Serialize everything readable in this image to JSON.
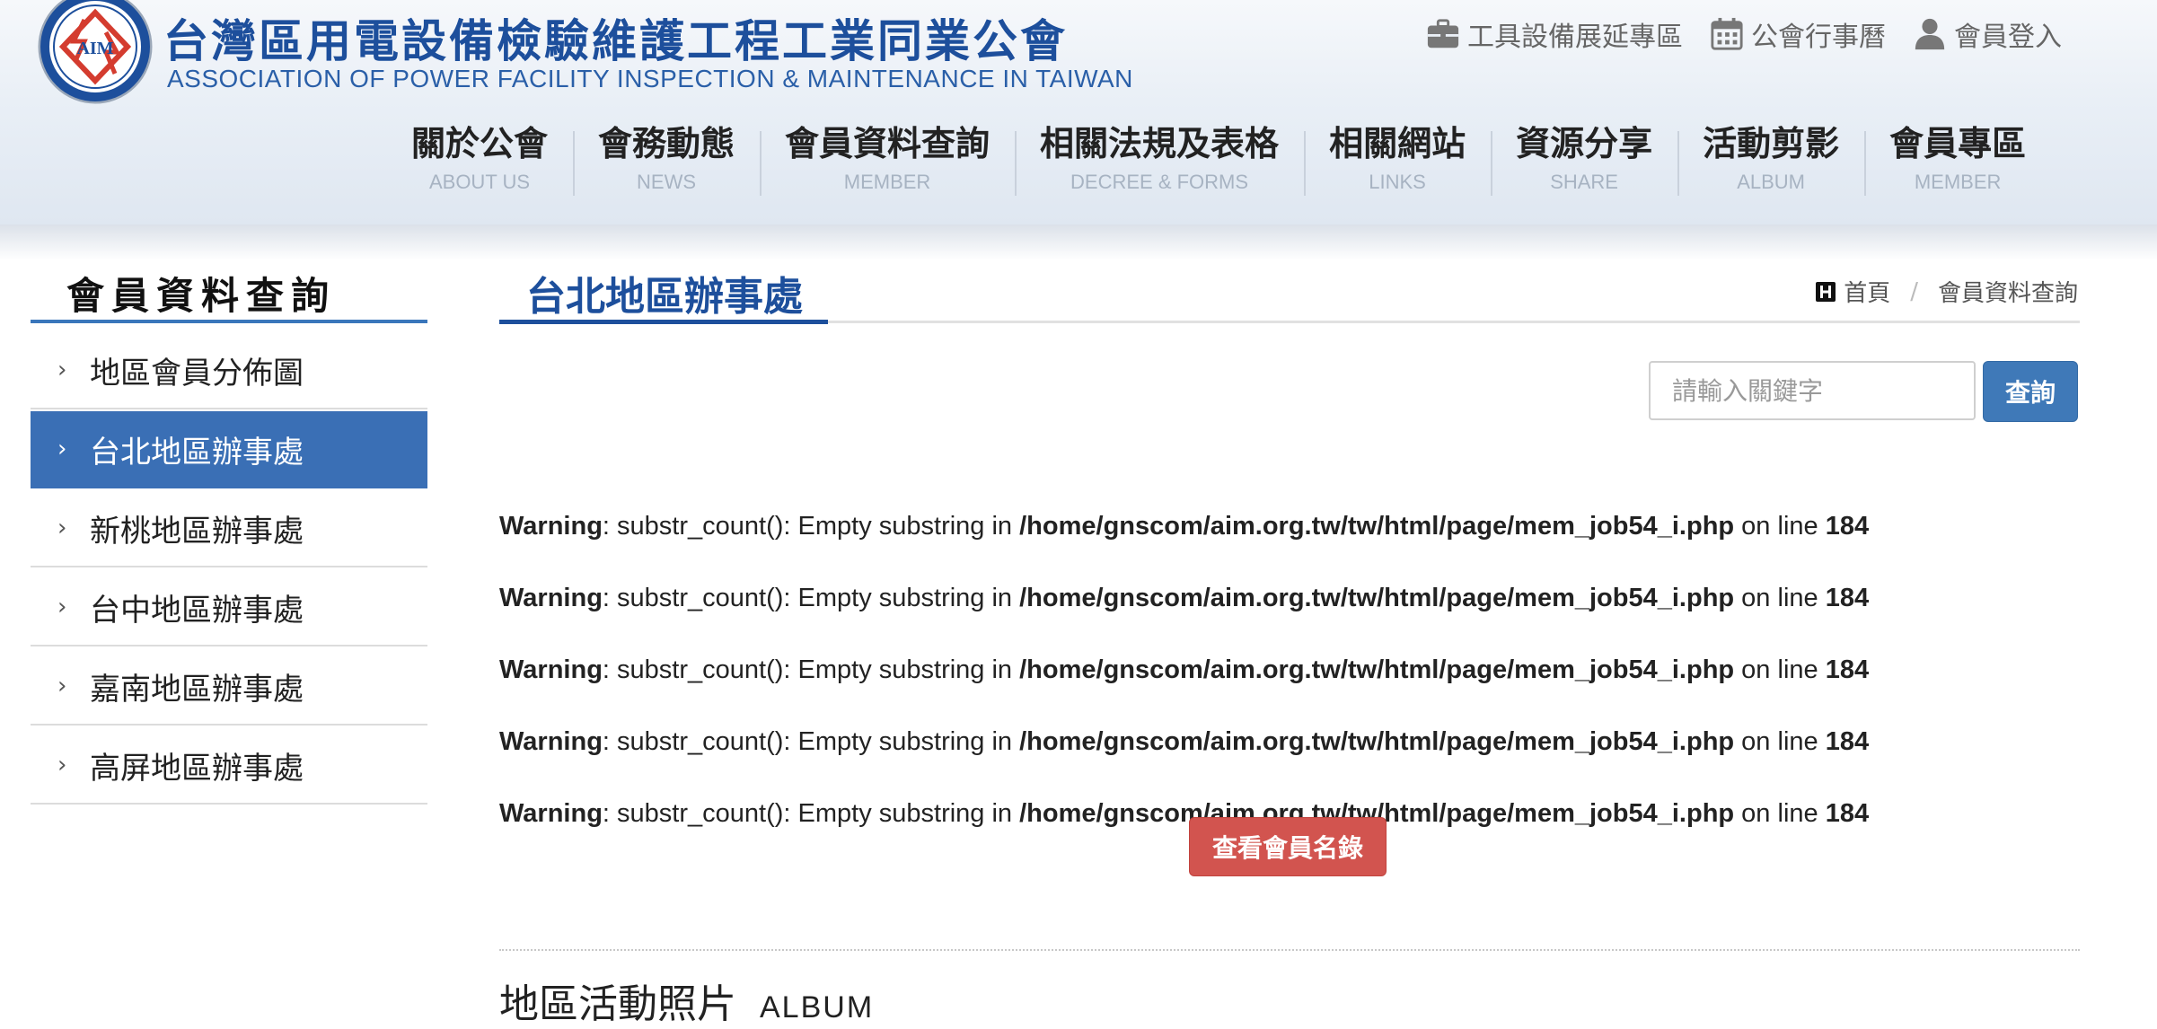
{
  "header": {
    "logo_text": "AIM",
    "title_zh": "台灣區用電設備檢驗維護工程工業同業公會",
    "title_en": "ASSOCIATION OF POWER FACILITY INSPECTION & MAINTENANCE IN TAIWAN",
    "top_links": [
      {
        "label": "工具設備展延專區",
        "icon": "briefcase-icon"
      },
      {
        "label": "公會行事曆",
        "icon": "calendar-icon"
      },
      {
        "label": "會員登入",
        "icon": "user-icon"
      }
    ],
    "nav": [
      {
        "zh": "關於公會",
        "en": "ABOUT US"
      },
      {
        "zh": "會務動態",
        "en": "NEWS"
      },
      {
        "zh": "會員資料查詢",
        "en": "MEMBER"
      },
      {
        "zh": "相關法規及表格",
        "en": "DECREE & FORMS"
      },
      {
        "zh": "相關網站",
        "en": "LINKS"
      },
      {
        "zh": "資源分享",
        "en": "SHARE"
      },
      {
        "zh": "活動剪影",
        "en": "ALBUM"
      },
      {
        "zh": "會員專區",
        "en": "MEMBER"
      }
    ]
  },
  "sidebar": {
    "title": "會員資料查詢",
    "items": [
      {
        "label": "地區會員分佈圖"
      },
      {
        "label": "台北地區辦事處",
        "active": true
      },
      {
        "label": "新桃地區辦事處"
      },
      {
        "label": "台中地區辦事處"
      },
      {
        "label": "嘉南地區辦事處"
      },
      {
        "label": "高屏地區辦事處"
      }
    ]
  },
  "main": {
    "title": "台北地區辦事處",
    "breadcrumb": {
      "home": "首頁",
      "current": "會員資料查詢"
    },
    "search": {
      "placeholder": "請輸入關鍵字",
      "button": "查詢"
    },
    "warnings": [
      {
        "label": "Warning",
        "message": ": substr_count(): Empty substring in ",
        "path": "/home/gnscom/aim.org.tw/tw/html/page/mem_job54_i.php",
        "on_line": " on line ",
        "line": "184"
      },
      {
        "label": "Warning",
        "message": ": substr_count(): Empty substring in ",
        "path": "/home/gnscom/aim.org.tw/tw/html/page/mem_job54_i.php",
        "on_line": " on line ",
        "line": "184"
      },
      {
        "label": "Warning",
        "message": ": substr_count(): Empty substring in ",
        "path": "/home/gnscom/aim.org.tw/tw/html/page/mem_job54_i.php",
        "on_line": " on line ",
        "line": "184"
      },
      {
        "label": "Warning",
        "message": ": substr_count(): Empty substring in ",
        "path": "/home/gnscom/aim.org.tw/tw/html/page/mem_job54_i.php",
        "on_line": " on line ",
        "line": "184"
      },
      {
        "label": "Warning",
        "message": ": substr_count(): Empty substring in ",
        "path": "/home/gnscom/aim.org.tw/tw/html/page/mem_job54_i.php",
        "on_line": " on line ",
        "line": "184"
      }
    ],
    "member_list_button": "查看會員名錄",
    "album_heading": {
      "zh": "地區活動照片",
      "en": "ALBUM"
    }
  },
  "colors": {
    "brand_blue": "#1d4f9c",
    "active_item": "#3a6fb5",
    "search_button": "#3f79b8",
    "member_button": "#d2544f"
  }
}
